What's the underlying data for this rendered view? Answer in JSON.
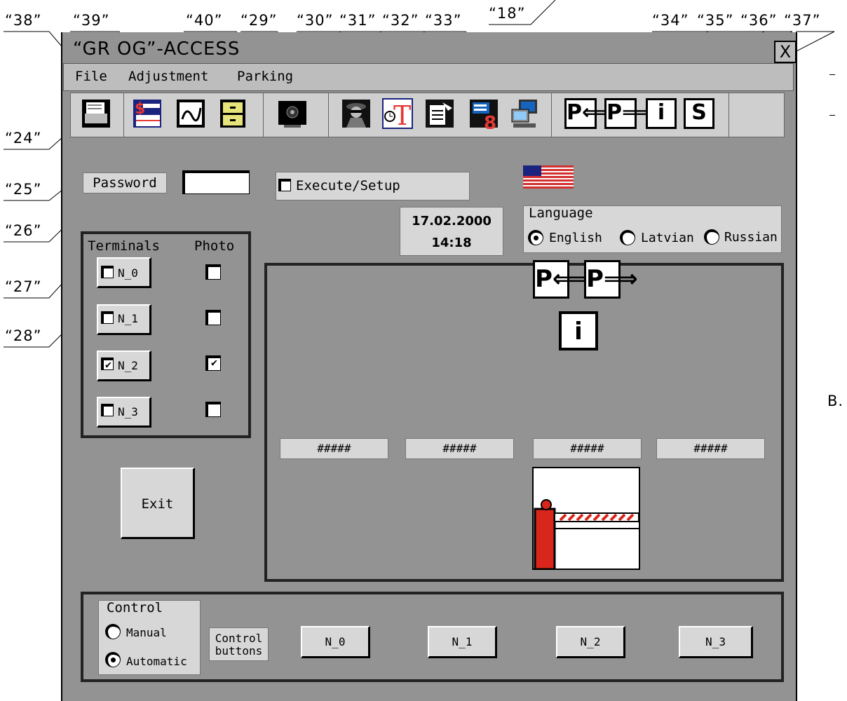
{
  "callouts": {
    "c18": "“18”",
    "c24": "“24”",
    "c25": "“25”",
    "c26": "“26”",
    "c27": "“27”",
    "c28": "“28”",
    "c29": "“29”",
    "c30": "“30”",
    "c31": "“31”",
    "c32": "“32”",
    "c33": "“33”",
    "c34": "“34”",
    "c35": "“35”",
    "c36": "“36”",
    "c37": "“37”",
    "c38": "“38”",
    "c39": "“39”",
    "c40": "“40”",
    "side_b": "B."
  },
  "window": {
    "title": "“GR OG”-ACCESS",
    "close": "X",
    "menu": [
      "File",
      "Adjustment",
      "Parking"
    ]
  },
  "toolbar": {
    "icons": [
      "printer-icon",
      "cash-register-icon",
      "signature-icon",
      "filing-cabinet-icon",
      "camera-icon",
      "spy-agent-icon",
      "time-schedule-icon",
      "document-edit-icon",
      "counter-icon",
      "computer-network-icon",
      "parking-entry-icon",
      "parking-exit-icon",
      "info-icon",
      "s-icon"
    ],
    "p_entry": "P",
    "p_exit": "P",
    "info": "i",
    "s": "S"
  },
  "password": {
    "label": "Password",
    "value": ""
  },
  "execute": {
    "label": "Execute/Setup",
    "checked": false
  },
  "flag": "us-flag-icon",
  "datetime": {
    "date": "17.02.2000",
    "time": "14:18"
  },
  "language": {
    "title": "Language",
    "options": [
      "English",
      "Latvian",
      "Russian"
    ],
    "selected": "English"
  },
  "terminals": {
    "header_terminals": "Terminals",
    "header_photo": "Photo",
    "rows": [
      {
        "name": "N_0",
        "terminal": false,
        "photo": false
      },
      {
        "name": "N_1",
        "terminal": false,
        "photo": false
      },
      {
        "name": "N_2",
        "terminal": true,
        "photo": true
      },
      {
        "name": "N_3",
        "terminal": false,
        "photo": false
      }
    ]
  },
  "exit_label": "Exit",
  "display": {
    "fields": [
      "#####",
      "#####",
      "#####",
      "#####"
    ],
    "p_entry": "P",
    "p_exit": "P",
    "info": "i"
  },
  "control": {
    "title": "Control",
    "modes": [
      "Manual",
      "Automatic"
    ],
    "selected": "Automatic",
    "buttons_label": "Control buttons",
    "buttons": [
      "N_0",
      "N_1",
      "N_2",
      "N_3"
    ]
  },
  "colors": {
    "window_bg": "#939393",
    "panel_bg": "#d7d7d7",
    "barrier_red": "#d8261c"
  }
}
